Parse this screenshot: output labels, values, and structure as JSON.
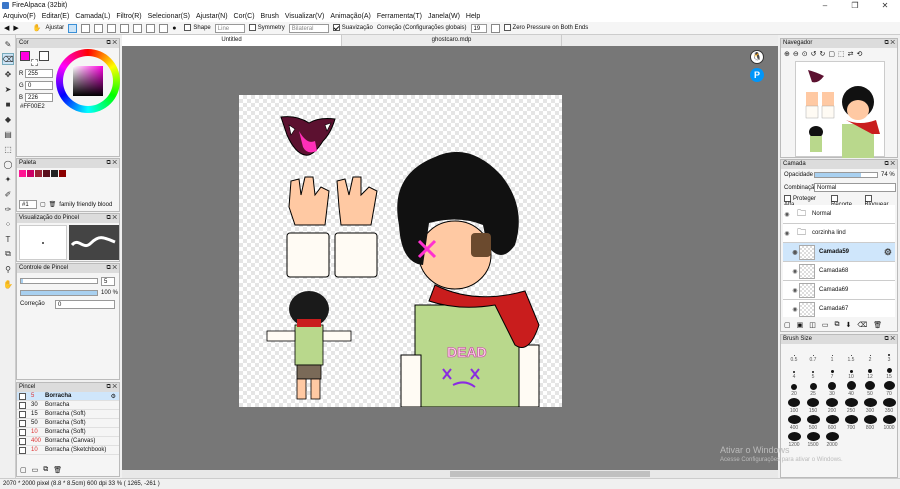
{
  "window": {
    "title": "FireAlpaca (32bit)"
  },
  "menu": [
    "Arquivo(F)",
    "Editar(E)",
    "Camada(L)",
    "Filtro(R)",
    "Selecionar(S)",
    "Ajustar(N)",
    "Cor(C)",
    "Brush",
    "Visualizar(V)",
    "Animação(A)",
    "Ferramenta(T)",
    "Janela(W)",
    "Help"
  ],
  "toolbar": {
    "ajustar": "Ajustar",
    "shape": "Shape",
    "shape_val": "Line",
    "symmetry": "Symmetry",
    "symmetry_val": "Bilateral",
    "suavizacao": "Suavização",
    "correcao": "Correção (Configurações globais)",
    "correcao_val": "19",
    "zero_pressure": "Zero Pressure on Both Ends"
  },
  "tabs": [
    "Untitled",
    "ghostcaro.mdp"
  ],
  "color_panel": {
    "title": "Cor",
    "r_label": "R",
    "r": "255",
    "g_label": "G",
    "g": "0",
    "b_label": "B",
    "b": "226",
    "hex": "#FF00E2",
    "primary": "#ff00e2"
  },
  "palette_panel": {
    "title": "Paleta",
    "index": "#1",
    "name": "family friendly blood",
    "swatches": [
      "#ff1493",
      "#cc0066",
      "#9b2335",
      "#5a0e1c",
      "#222222",
      "#8b0000"
    ]
  },
  "brush_preview": {
    "title": "Visualização do Pincel"
  },
  "brush_control": {
    "title": "Controle de Pincel",
    "size": "5",
    "opacity": "100 %",
    "opacity_value": 1.0,
    "correction_label": "Correção",
    "correction": "0"
  },
  "brush_list": {
    "title": "Pincel",
    "items": [
      {
        "size": "5",
        "name": "Borracha"
      },
      {
        "size": "30",
        "name": "Borracha"
      },
      {
        "size": "15",
        "name": "Borracha (Soft)"
      },
      {
        "size": "50",
        "name": "Borracha (Soft)"
      },
      {
        "size": "10",
        "name": "Borracha (Soft)"
      },
      {
        "size": "400",
        "name": "Borracha (Canvas)"
      },
      {
        "size": "10",
        "name": "Borracha (Sketchbook)"
      }
    ]
  },
  "navigator": {
    "title": "Navegador"
  },
  "layer_panel": {
    "title": "Camada",
    "opacity_label": "Opacidade",
    "opacity": "74 %",
    "opacity_value": 0.74,
    "blend_label": "Combinação",
    "blend": "Normal",
    "protect_alpha": "Proteger Alfa",
    "clipping": "Recorte",
    "lock": "Bloquear",
    "layers": [
      {
        "name": "Normal",
        "type": "folder"
      },
      {
        "name": "corzinha lind",
        "type": "folder"
      },
      {
        "name": "Camada59",
        "type": "layer"
      },
      {
        "name": "Camada68",
        "type": "layer"
      },
      {
        "name": "Camada69",
        "type": "layer"
      },
      {
        "name": "Camada67",
        "type": "layer"
      }
    ]
  },
  "brush_size": {
    "title": "Brush Size",
    "labels": [
      "0.5",
      "0.7",
      "1",
      "1.5",
      "2",
      "3",
      "4",
      "5",
      "7",
      "10",
      "12",
      "15",
      "20",
      "25",
      "30",
      "40",
      "50",
      "70",
      "100",
      "150",
      "200",
      "250",
      "300",
      "350",
      "400",
      "500",
      "600",
      "700",
      "800",
      "1000",
      "1200",
      "1500",
      "2000"
    ]
  },
  "status": "2070 * 2000 pixel  (8.8 * 8.5cm)  600 dpi  33 %  ( 1265, -261 )",
  "watermark": {
    "line1": "Ativar o Windows",
    "line2": "Acesse Configurações para ativar o Windows."
  }
}
